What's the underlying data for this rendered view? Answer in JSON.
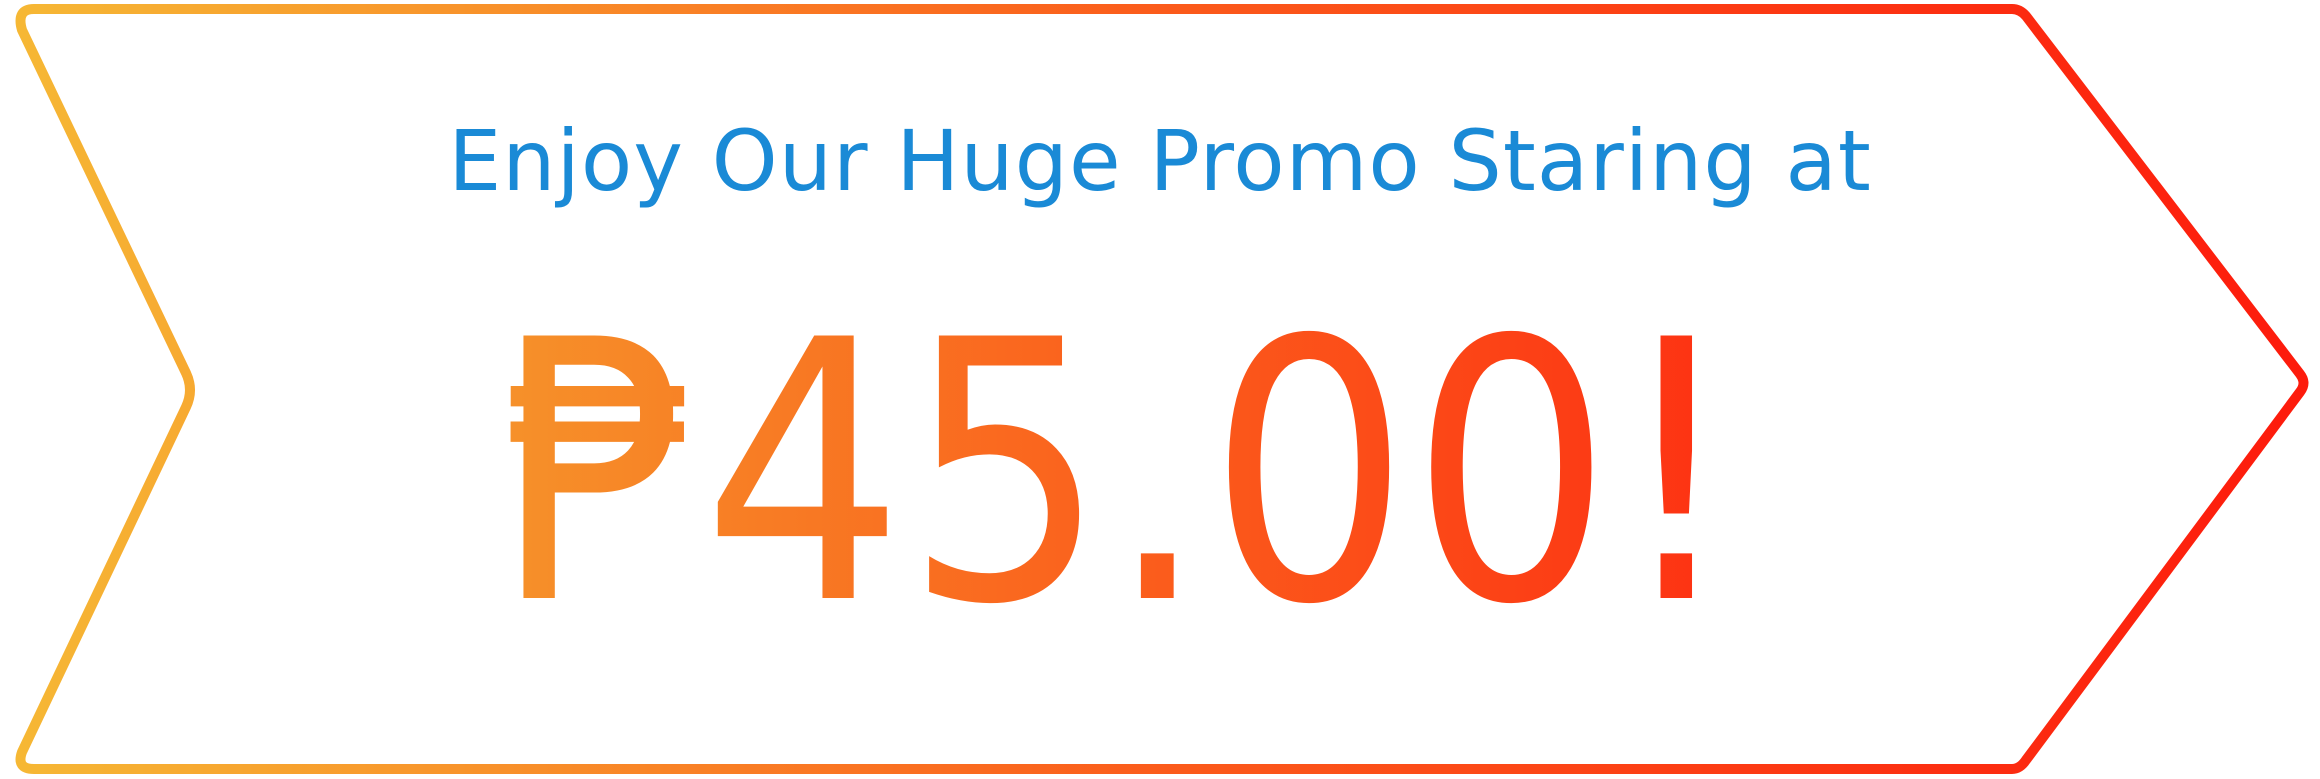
{
  "banner": {
    "headline": "Enjoy Our Huge Promo Staring at",
    "price": "₱45.00!",
    "colors": {
      "headline": "#1a8ad6",
      "gradient_start": "#f6b935",
      "gradient_mid": "#fb5b1b",
      "gradient_end": "#fd1a0c"
    }
  }
}
